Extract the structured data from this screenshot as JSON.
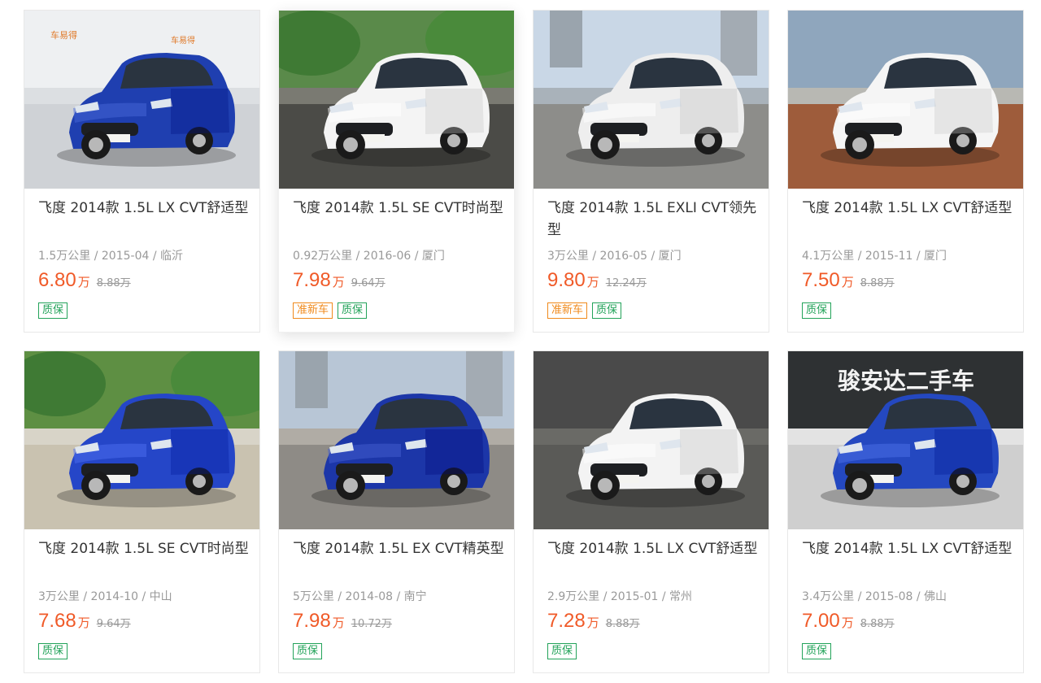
{
  "colors": {
    "price": "#f05a28",
    "tag_green": "#23a35a",
    "tag_orange": "#f08a1c"
  },
  "listings": [
    {
      "title": "飞度 2014款 1.5L LX CVT舒适型",
      "mileage": "1.5万公里",
      "date": "2015-04",
      "city": "临沂",
      "price": "6.80",
      "price_unit": "万",
      "original_price": "8.88万",
      "tags": [
        {
          "label": "质保",
          "style": "green"
        }
      ],
      "photo": {
        "car_color": "#1f3fb0",
        "scene": "showroom",
        "sign": [
          "车易得",
          "车易得"
        ]
      }
    },
    {
      "title": "飞度 2014款 1.5L SE CVT时尚型",
      "mileage": "0.92万公里",
      "date": "2016-06",
      "city": "厦门",
      "price": "7.98",
      "price_unit": "万",
      "original_price": "9.64万",
      "tags": [
        {
          "label": "准新车",
          "style": "orange"
        },
        {
          "label": "质保",
          "style": "green"
        }
      ],
      "photo": {
        "car_color": "#f4f4f4",
        "scene": "street"
      }
    },
    {
      "title": "飞度 2014款 1.5L EXLI CVT领先型",
      "mileage": "3万公里",
      "date": "2016-05",
      "city": "厦门",
      "price": "9.80",
      "price_unit": "万",
      "original_price": "12.24万",
      "tags": [
        {
          "label": "准新车",
          "style": "orange"
        },
        {
          "label": "质保",
          "style": "green"
        }
      ],
      "photo": {
        "car_color": "#eeeeee",
        "scene": "plaza"
      }
    },
    {
      "title": "飞度 2014款 1.5L LX CVT舒适型",
      "mileage": "4.1万公里",
      "date": "2015-11",
      "city": "厦门",
      "price": "7.50",
      "price_unit": "万",
      "original_price": "8.88万",
      "tags": [
        {
          "label": "质保",
          "style": "green"
        }
      ],
      "photo": {
        "car_color": "#f5f5f5",
        "scene": "sidewalk"
      }
    },
    {
      "title": "飞度 2014款 1.5L SE CVT时尚型",
      "mileage": "3万公里",
      "date": "2014-10",
      "city": "中山",
      "price": "7.68",
      "price_unit": "万",
      "original_price": "9.64万",
      "tags": [
        {
          "label": "质保",
          "style": "green"
        }
      ],
      "photo": {
        "car_color": "#2546c8",
        "scene": "parking"
      }
    },
    {
      "title": "飞度 2014款 1.5L EX CVT精英型",
      "mileage": "5万公里",
      "date": "2014-08",
      "city": "南宁",
      "price": "7.98",
      "price_unit": "万",
      "original_price": "10.72万",
      "tags": [
        {
          "label": "质保",
          "style": "green"
        }
      ],
      "photo": {
        "car_color": "#1c36a8",
        "scene": "city"
      }
    },
    {
      "title": "飞度 2014款 1.5L LX CVT舒适型",
      "mileage": "2.9万公里",
      "date": "2015-01",
      "city": "常州",
      "price": "7.28",
      "price_unit": "万",
      "original_price": "8.88万",
      "tags": [
        {
          "label": "质保",
          "style": "green"
        }
      ],
      "photo": {
        "car_color": "#f3f3f3",
        "scene": "garage"
      }
    },
    {
      "title": "飞度 2014款 1.5L LX CVT舒适型",
      "mileage": "3.4万公里",
      "date": "2015-08",
      "city": "佛山",
      "price": "7.00",
      "price_unit": "万",
      "original_price": "8.88万",
      "tags": [
        {
          "label": "质保",
          "style": "green"
        }
      ],
      "photo": {
        "car_color": "#2448c0",
        "scene": "dealer",
        "sign": [
          "骏安达二手车"
        ]
      }
    }
  ]
}
